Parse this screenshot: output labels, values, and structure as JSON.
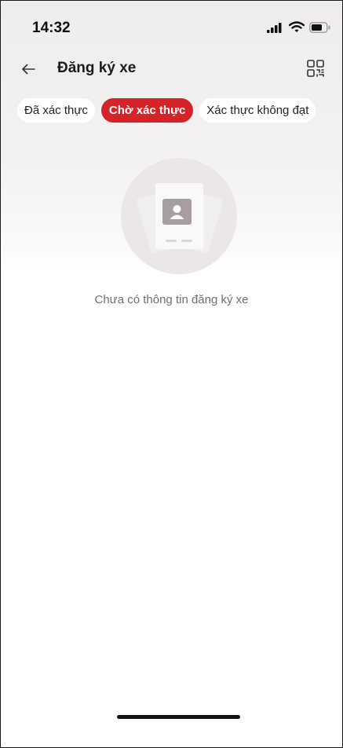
{
  "status_bar": {
    "time": "14:32"
  },
  "header": {
    "title": "Đăng ký xe",
    "back_icon": "arrow-left-icon",
    "qr_icon": "qr-scan-icon"
  },
  "tabs": [
    {
      "label": "Đã xác thực",
      "active": false
    },
    {
      "label": "Chờ xác thực",
      "active": true
    },
    {
      "label": "Xác thực không đạt",
      "active": false
    }
  ],
  "empty_state": {
    "message": "Chưa có thông tin đăng ký xe",
    "icon": "id-card-icon"
  },
  "colors": {
    "accent": "#d4242a",
    "background_top": "#efecec",
    "text_muted": "#6f6f6f"
  }
}
